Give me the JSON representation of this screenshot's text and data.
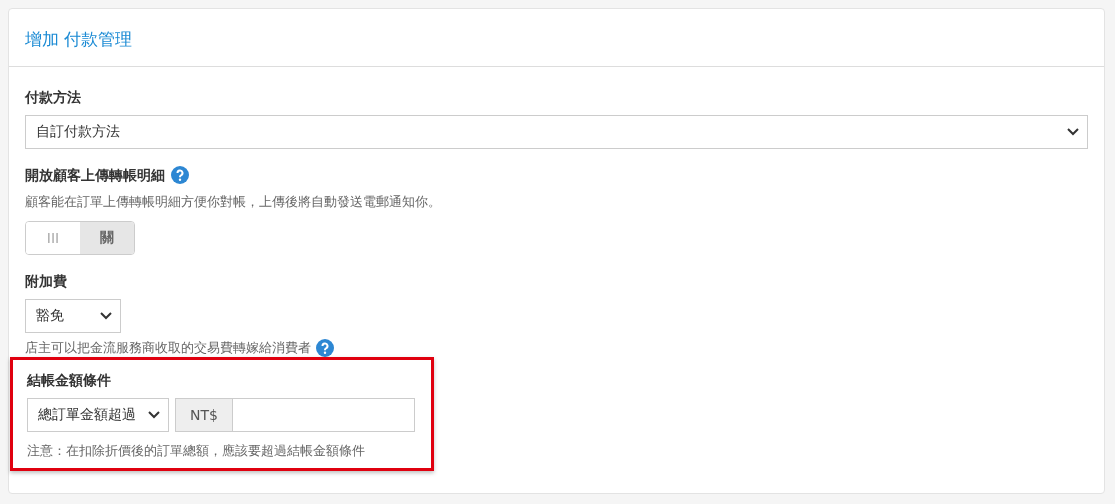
{
  "title": "增加 付款管理",
  "payment_method": {
    "label": "付款方法",
    "value": "自訂付款方法"
  },
  "upload_receipt": {
    "label": "開放顧客上傳轉帳明細",
    "help": "顧客能在訂單上傳轉帳明細方便你對帳，上傳後將自動發送電郵通知你。",
    "toggle": [
      {
        "label": "III",
        "selected": false
      },
      {
        "label": "關",
        "selected": true
      }
    ]
  },
  "surcharge": {
    "label": "附加費",
    "value": "豁免",
    "help": "店主可以把金流服務商收取的交易費轉嫁給消費者"
  },
  "checkout_amount": {
    "label": "結帳金額條件",
    "highlighted": true,
    "condition": "總訂單金額超過",
    "currency": "NT$",
    "note": "注意：在扣除折價後的訂單總額，應該要超過結帳金額條件"
  }
}
